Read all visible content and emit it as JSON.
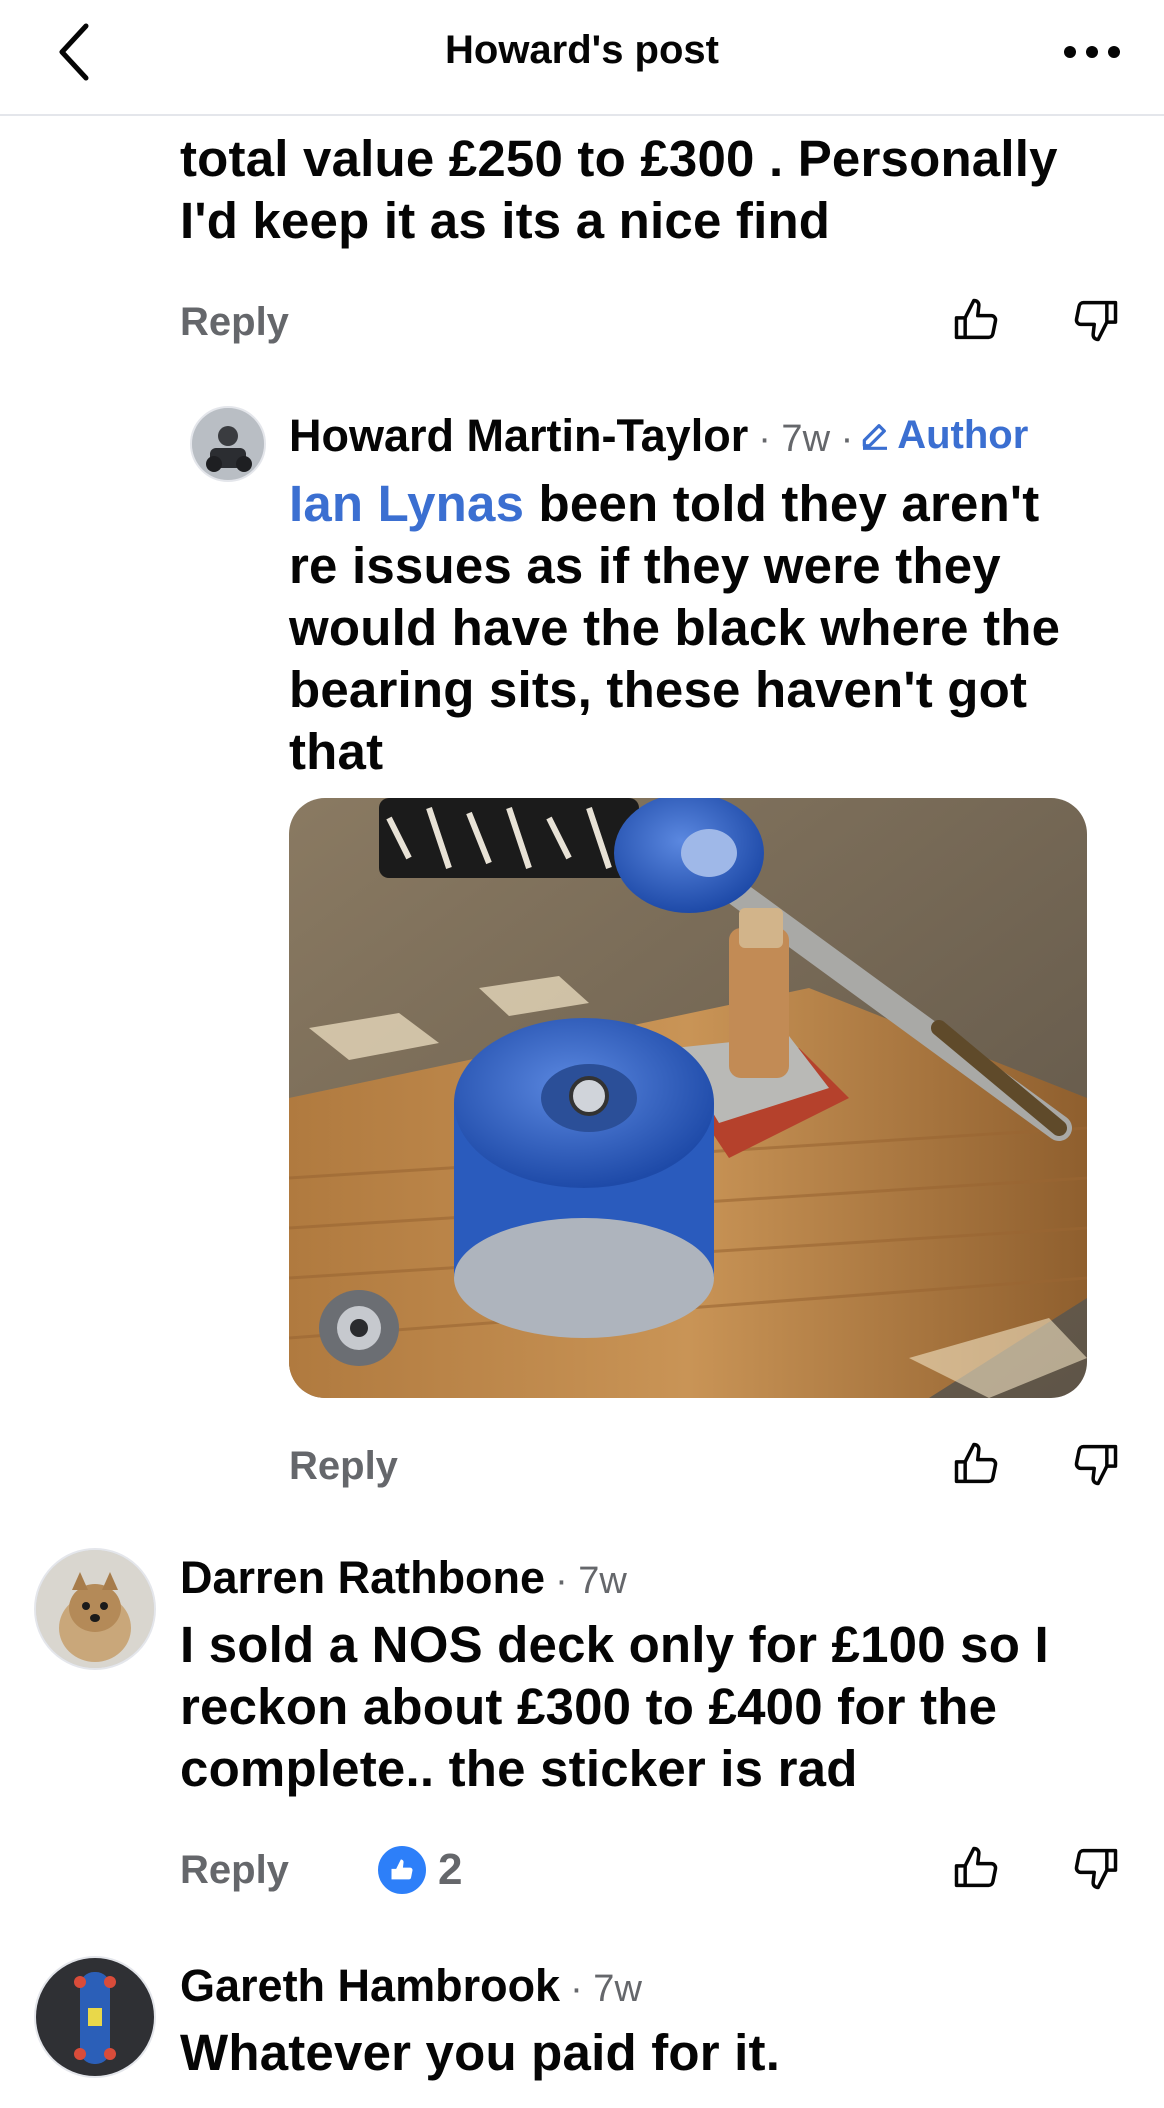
{
  "nav": {
    "title": "Howard's post",
    "back_icon": "chevron-left-icon",
    "more_icon": "more-horizontal-icon"
  },
  "comments": [
    {
      "text_lines": [
        "total value £250 to £300 . Personally",
        "I'd keep it as its a nice find"
      ],
      "reply_label": "Reply"
    },
    {
      "author": "Howard Martin-Taylor",
      "meta": "· 7w ·",
      "badge": "Author",
      "mention": "Ian Lynas",
      "text_first_rest": " been told they aren't",
      "text_lines": [
        "re issues as if they were they",
        "would have the black where the",
        "bearing sits, these haven't got",
        "that"
      ],
      "reply_label": "Reply",
      "photo_description_icon": "skateboard-truck-photo"
    },
    {
      "author": "Darren Rathbone",
      "meta": "· 7w",
      "text_lines": [
        "I sold a NOS deck only for £100 so I",
        "reckon about £300 to £400 for the",
        "complete.. the sticker is rad"
      ],
      "reply_label": "Reply",
      "reaction_count": "2"
    },
    {
      "author": "Gareth Hambrook",
      "meta": "· 7w",
      "text_lines": [
        "Whatever you paid for it."
      ]
    }
  ],
  "colors": {
    "accent": "#3b6fd1",
    "secondary_text": "#65676b",
    "like_blue": "#2d7ff9"
  }
}
